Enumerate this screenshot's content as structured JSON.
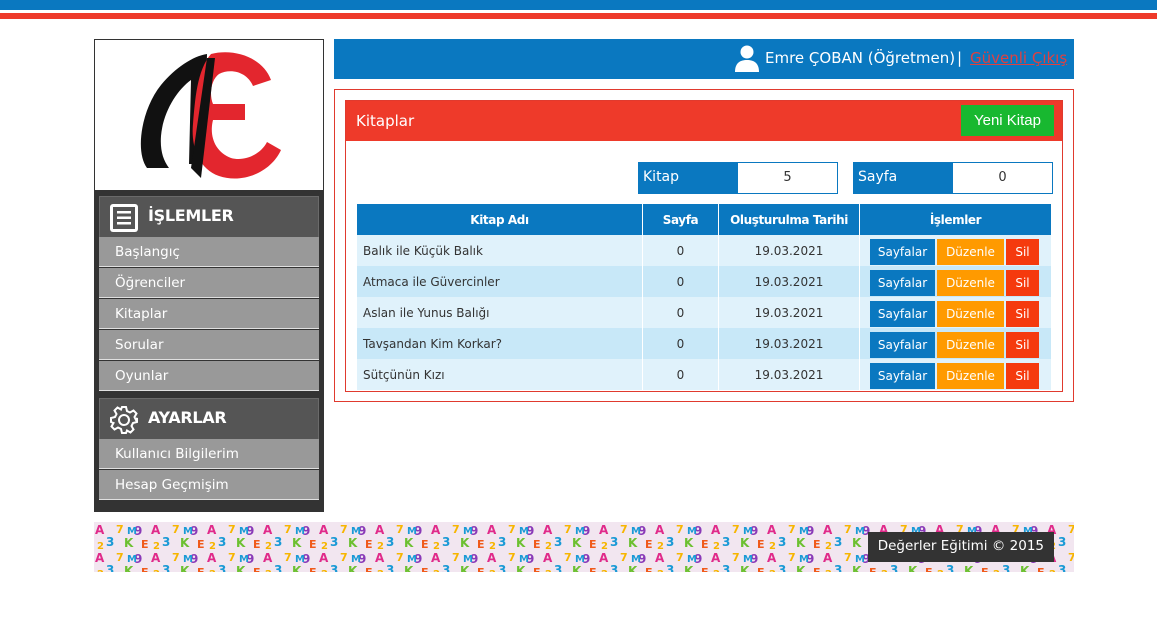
{
  "colors": {
    "primary_blue": "#0a78c0",
    "panel_red": "#ee3a2a",
    "new_button_green": "#18b830",
    "edit_orange": "#ff9a00",
    "delete_red": "#f53a0e",
    "sidebar_dark": "#333333"
  },
  "sidebar": {
    "logo_icon": "ae-logo-icon",
    "sections": [
      {
        "title": "İŞLEMLER",
        "icon": "list-icon",
        "items": [
          {
            "label": "Başlangıç"
          },
          {
            "label": "Öğrenciler"
          },
          {
            "label": "Kitaplar"
          },
          {
            "label": "Sorular"
          },
          {
            "label": "Oyunlar"
          }
        ]
      },
      {
        "title": "AYARLAR",
        "icon": "gear-icon",
        "items": [
          {
            "label": "Kullanıcı Bilgilerim"
          },
          {
            "label": "Hesap Geçmişim"
          }
        ]
      }
    ]
  },
  "userbar": {
    "icon": "user-icon",
    "user_name": "Emre ÇOBAN (Öğretmen)",
    "separator": "|",
    "logout_label": "Güvenli Çıkış"
  },
  "panel": {
    "title": "Kitaplar",
    "new_button_label": "Yeni Kitap",
    "stats": [
      {
        "label": "Kitap",
        "value": "5"
      },
      {
        "label": "Sayfa",
        "value": "0"
      }
    ]
  },
  "table": {
    "headers": [
      "Kitap Adı",
      "Sayfa",
      "Oluşturulma Tarihi",
      "İşlemler"
    ],
    "action_labels": {
      "pages": "Sayfalar",
      "edit": "Düzenle",
      "delete": "Sil"
    },
    "rows": [
      {
        "name": "Balık ile Küçük Balık",
        "pages": "0",
        "date": "19.03.2021"
      },
      {
        "name": "Atmaca ile Güvercinler",
        "pages": "0",
        "date": "19.03.2021"
      },
      {
        "name": "Aslan ile Yunus Balığı",
        "pages": "0",
        "date": "19.03.2021"
      },
      {
        "name": "Tavşandan Kim Korkar?",
        "pages": "0",
        "date": "19.03.2021"
      },
      {
        "name": "Sütçünün Kızı",
        "pages": "0",
        "date": "19.03.2021"
      }
    ]
  },
  "footer": {
    "pattern": "colorful-letters-numbers-pattern",
    "copyright": "Değerler Eğitimi © 2015"
  }
}
